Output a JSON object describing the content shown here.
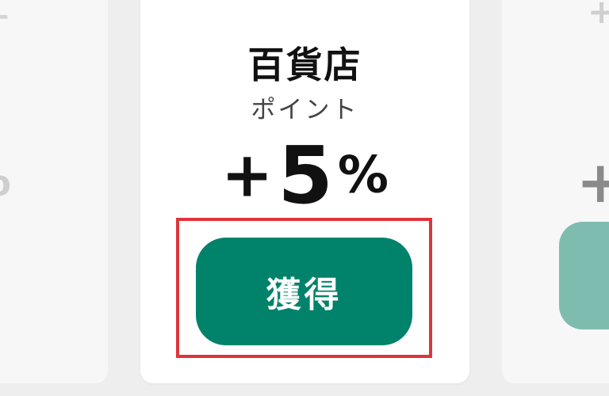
{
  "center_card": {
    "title": "百貨店",
    "subtitle": "ポイント",
    "value_sign": "+",
    "value_number": "5",
    "value_unit": "%",
    "button_label": "獲得"
  },
  "left_card": {
    "top_glyph": "+",
    "mid_glyph": "/",
    "value_unit": "%"
  },
  "right_card": {
    "top_glyph": "+",
    "value_sign": "+"
  },
  "colors": {
    "button": "#00826b",
    "highlight_border": "#e0333a",
    "background": "#eeeeee",
    "card": "#ffffff"
  }
}
